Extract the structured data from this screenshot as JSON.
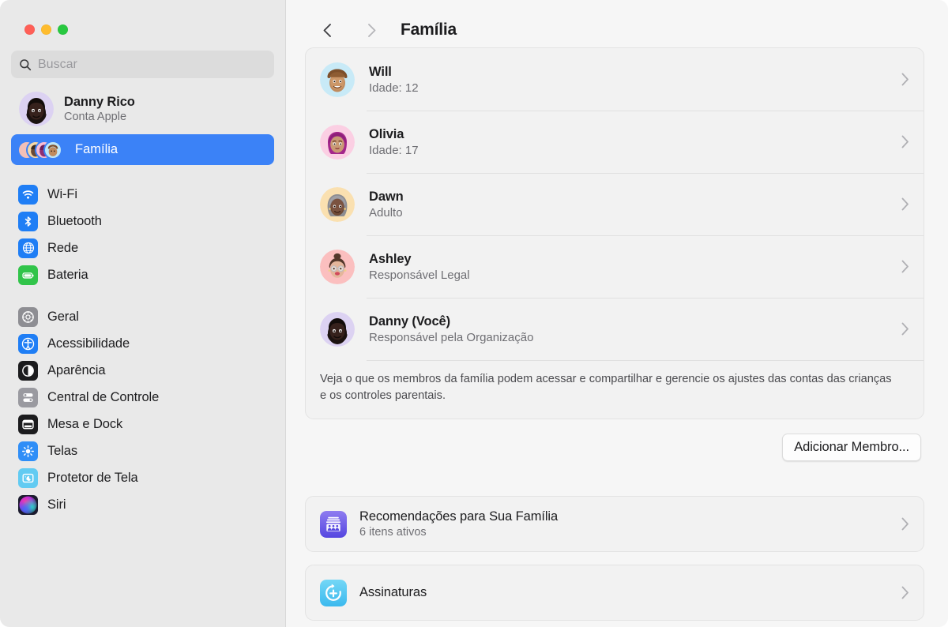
{
  "window": {
    "traffic_lights": [
      "close",
      "minimize",
      "maximize"
    ],
    "colors": {
      "close": "#ff5f57",
      "minimize": "#febc2e",
      "maximize": "#28c840",
      "accent": "#3b82f7"
    }
  },
  "sidebar": {
    "search": {
      "placeholder": "Buscar",
      "value": "",
      "icon": "search-icon"
    },
    "profile": {
      "name": "Danny Rico",
      "subtitle": "Conta Apple",
      "avatar": "memoji-danny"
    },
    "family_item": {
      "label": "Família",
      "selected": true,
      "icon": "family-avatars-icon"
    },
    "groups": [
      {
        "items": [
          {
            "label": "Wi-Fi",
            "icon": "wifi-icon",
            "color": "#1f7ef5"
          },
          {
            "label": "Bluetooth",
            "icon": "bluetooth-icon",
            "color": "#1f7ef5"
          },
          {
            "label": "Rede",
            "icon": "globe-icon",
            "color": "#1f7ef5"
          },
          {
            "label": "Bateria",
            "icon": "battery-icon",
            "color": "#31c44a"
          }
        ]
      },
      {
        "items": [
          {
            "label": "Geral",
            "icon": "gear-icon",
            "color": "#8e8e93"
          },
          {
            "label": "Acessibilidade",
            "icon": "accessibility-icon",
            "color": "#1f7ef5"
          },
          {
            "label": "Aparência",
            "icon": "appearance-icon",
            "color": "#1c1c1e"
          },
          {
            "label": "Central de Controle",
            "icon": "control-center-icon",
            "color": "#8e8e93"
          },
          {
            "label": "Mesa e Dock",
            "icon": "desktop-dock-icon",
            "color": "#1c1c1e"
          },
          {
            "label": "Telas",
            "icon": "displays-icon",
            "color": "#2f8ef7"
          },
          {
            "label": "Protetor de Tela",
            "icon": "screensaver-icon",
            "color": "#5ac8f5"
          },
          {
            "label": "Siri",
            "icon": "siri-icon",
            "color": "#c645c0"
          }
        ]
      }
    ]
  },
  "header": {
    "back": "‹",
    "forward": "›",
    "title": "Família"
  },
  "main": {
    "members": [
      {
        "name": "Will",
        "role": "Idade: 12",
        "avatar": "memoji-will",
        "chevron": "chevron-right-icon"
      },
      {
        "name": "Olivia",
        "role": "Idade: 17",
        "avatar": "memoji-olivia",
        "chevron": "chevron-right-icon"
      },
      {
        "name": "Dawn",
        "role": "Adulto",
        "avatar": "memoji-dawn",
        "chevron": "chevron-right-icon"
      },
      {
        "name": "Ashley",
        "role": "Responsável Legal",
        "avatar": "memoji-ashley",
        "chevron": "chevron-right-icon"
      },
      {
        "name": "Danny (Você)",
        "role": "Responsável pela Organização",
        "avatar": "memoji-danny",
        "chevron": "chevron-right-icon"
      }
    ],
    "description": "Veja o que os membros da família podem acessar e compartilhar e gerencie os ajustes das contas das crianças e os controles parentais.",
    "add_member_button": "Adicionar Membro...",
    "links": [
      {
        "title": "Recomendações para Sua Família",
        "subtitle": "6 itens ativos",
        "icon": "recommendations-icon",
        "chevron": "chevron-right-icon"
      },
      {
        "title": "Assinaturas",
        "subtitle": "",
        "icon": "subscriptions-icon",
        "chevron": "chevron-right-icon"
      }
    ]
  }
}
